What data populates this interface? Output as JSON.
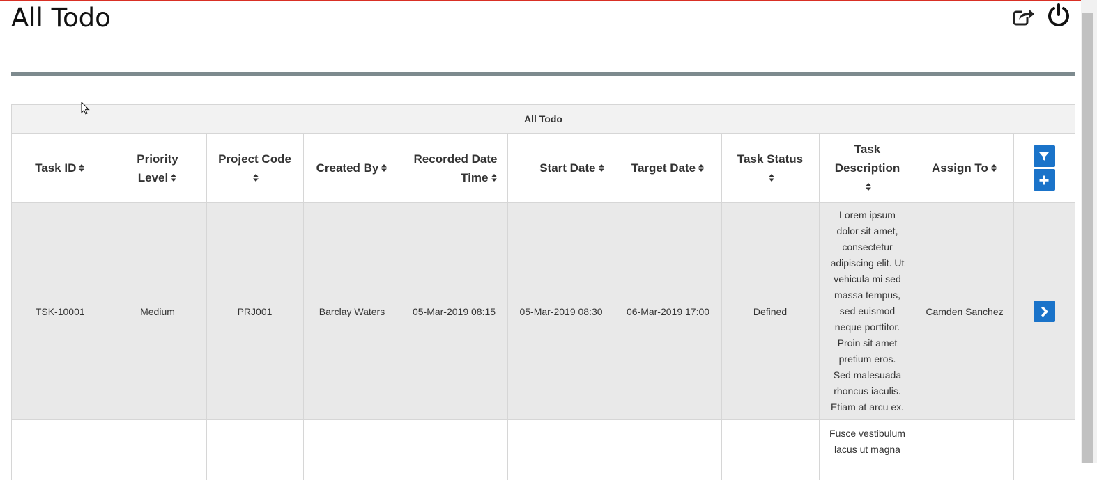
{
  "page": {
    "title": "All Todo"
  },
  "header": {
    "share_icon": "share-icon",
    "power_icon": "power-icon"
  },
  "colors": {
    "accent": "#1a73c9",
    "divider": "#7d8a8e",
    "top_border": "#d93025",
    "row_highlight": "#e9e9e9"
  },
  "table": {
    "caption": "All Todo",
    "columns": [
      {
        "key": "task_id",
        "line1": "Task ID",
        "line2": ""
      },
      {
        "key": "priority",
        "line1": "Priority",
        "line2": "Level"
      },
      {
        "key": "project",
        "line1": "Project Code",
        "line2": ""
      },
      {
        "key": "created_by",
        "line1": "Created By",
        "line2": ""
      },
      {
        "key": "recorded",
        "line1": "Recorded Date",
        "line2": "Time"
      },
      {
        "key": "start",
        "line1": "Start Date",
        "line2": ""
      },
      {
        "key": "target",
        "line1": "Target Date",
        "line2": ""
      },
      {
        "key": "status",
        "line1": "Task Status",
        "line2": ""
      },
      {
        "key": "description",
        "line1": "Task",
        "line2": "Description"
      },
      {
        "key": "assign",
        "line1": "Assign To",
        "line2": ""
      }
    ],
    "rows": [
      {
        "task_id": "TSK-10001",
        "priority": "Medium",
        "project": "PRJ001",
        "created_by": "Barclay Waters",
        "recorded": "05-Mar-2019 08:15",
        "start": "05-Mar-2019 08:30",
        "target": "06-Mar-2019 17:00",
        "status": "Defined",
        "description": [
          "Lorem ipsum",
          "dolor sit amet,",
          "consectetur",
          "adipiscing elit. Ut",
          "vehicula mi sed",
          "massa tempus,",
          "sed euismod",
          "neque porttitor.",
          "Proin sit amet",
          "pretium eros.",
          "Sed malesuada",
          "rhoncus iaculis.",
          "Etiam at arcu ex."
        ],
        "assign": "Camden Sanchez"
      },
      {
        "task_id": "",
        "priority": "",
        "project": "",
        "created_by": "",
        "recorded": "",
        "start": "",
        "target": "",
        "status": "",
        "description": [
          "Fusce vestibulum",
          "lacus ut magna"
        ],
        "assign": ""
      }
    ]
  }
}
